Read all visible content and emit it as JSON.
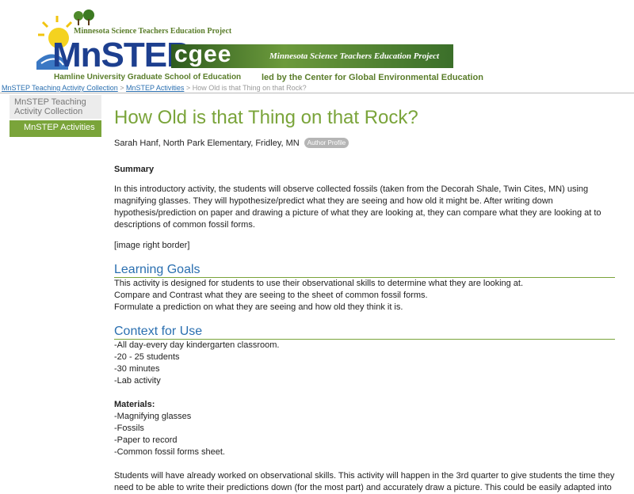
{
  "banner": {
    "top_tag": "Minnesota Science Teachers Education Project",
    "logo": "MnSTEP",
    "subtitle": "Hamline University Graduate School of Education",
    "cgee_logo": "cgee",
    "cgee_tag": "Minnesota Science Teachers Education Project",
    "cgee_subtitle": "led by the Center for Global Environmental Education"
  },
  "breadcrumb": {
    "link1": "MnSTEP Teaching Activity Collection",
    "sep1": ">",
    "link2": "MnSTEP Activities",
    "sep2": ">",
    "current": "How Old is that Thing on that Rock?"
  },
  "leftnav": {
    "item1": "MnSTEP Teaching Activity Collection",
    "item2": "MnSTEP Activities"
  },
  "main": {
    "title": "How Old is that Thing on that Rock?",
    "author": "Sarah Hanf, North Park Elementary, Fridley, MN",
    "author_badge": "Author Profile",
    "summary_heading": "Summary",
    "summary_text": "In this introductory activity, the students will observe collected fossils (taken from the Decorah Shale, Twin Cites, MN) using magnifying glasses. They will hypothesize/predict what they are seeing and how old it might be. After writing down hypothesis/prediction on paper and drawing a picture of what they are looking at, they can compare what they are looking at to descriptions of common fossil forms.",
    "image_placeholder": "[image right border]",
    "learning_goals_heading": "Learning Goals",
    "learning_goals": [
      "This activity is designed for students to use their observational skills to determine what they are looking at.",
      "Compare and Contrast what they are seeing to the sheet of common fossil forms.",
      "Formulate a prediction on what they are seeing and how old they think it is."
    ],
    "context_heading": "Context for Use",
    "context": [
      "-All day-every day kindergarten classroom.",
      "-20 - 25 students",
      "-30 minutes",
      "-Lab activity"
    ],
    "materials_heading": "Materials:",
    "materials": [
      "-Magnifying glasses",
      "-Fossils",
      "-Paper to record",
      "-Common fossil forms sheet."
    ],
    "closing_text": "Students will have already worked on observational skills. This activity will happen in the 3rd quarter to give students the time they need to be able to write their predictions down (for the most part) and accurately draw a picture. This could be easily adapted into"
  },
  "colors": {
    "green": "#7aa43a",
    "blue": "#2a6fb0",
    "logo_blue": "#1d3f8f"
  }
}
